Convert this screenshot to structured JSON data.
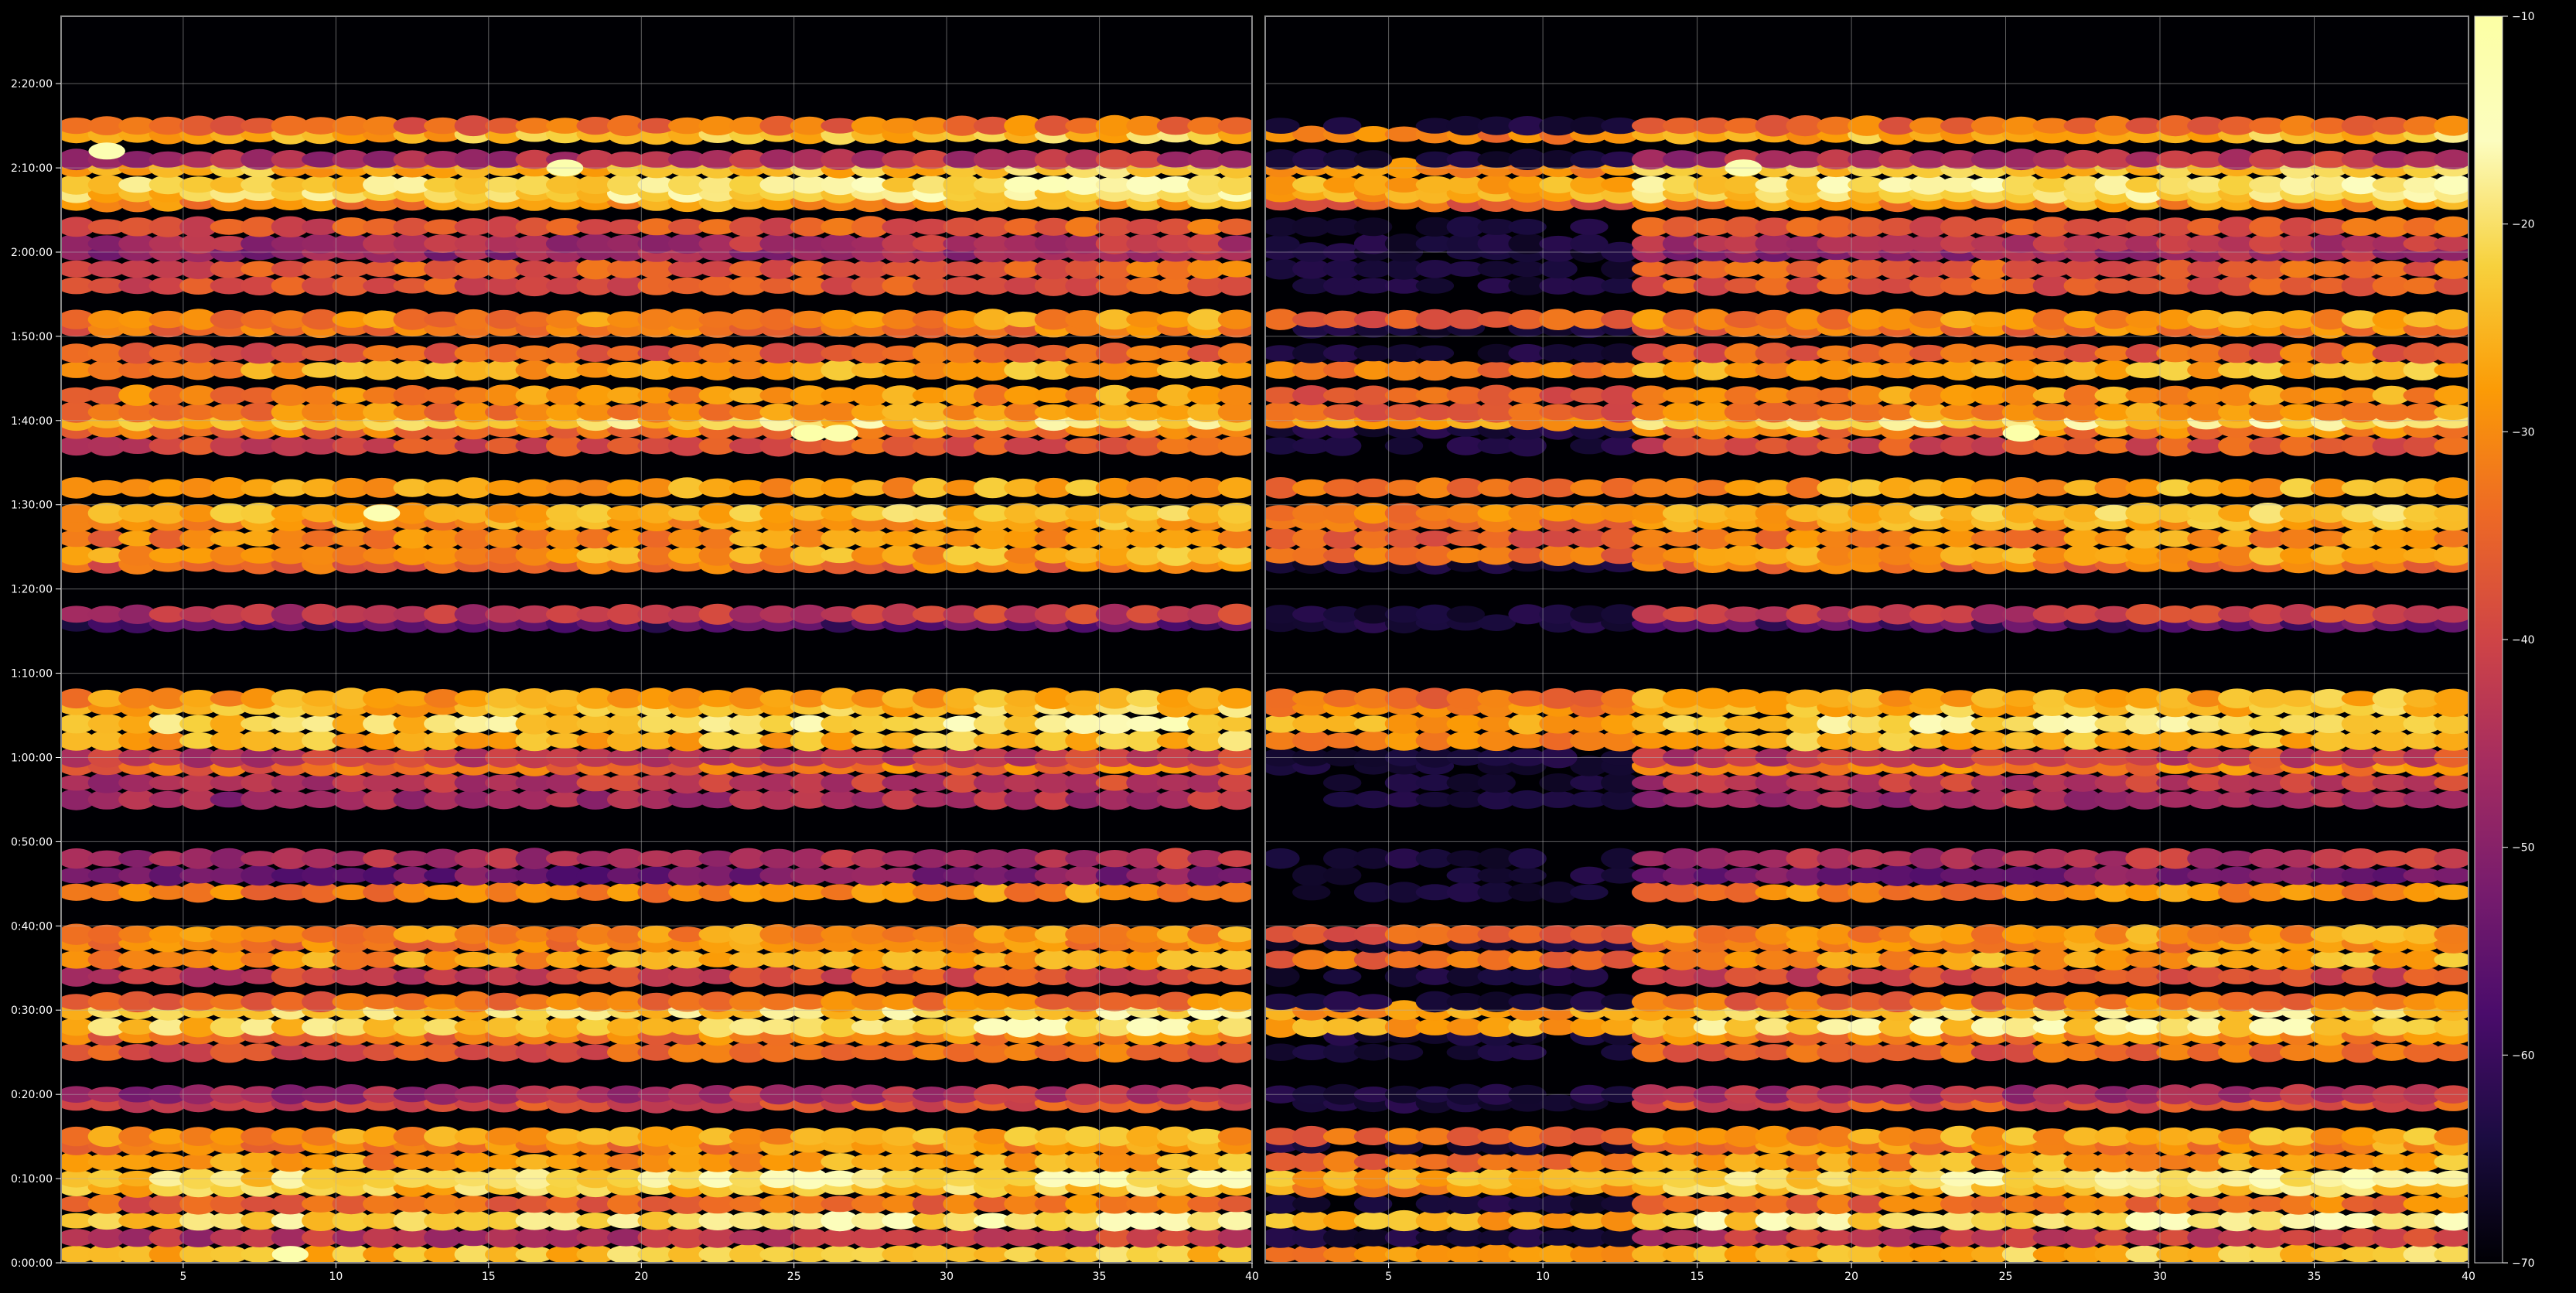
{
  "chart_data": {
    "type": "heatmap",
    "title": "",
    "xlabel": "",
    "ylabel": "",
    "colormap": "inferno",
    "background_color": "#000000",
    "grid": true,
    "panels": [
      {
        "name": "",
        "xlim": [
          1,
          40
        ],
        "xticks": [
          5,
          10,
          15,
          20,
          25,
          30,
          35,
          40
        ],
        "x_tick_labels": [
          "5",
          "10",
          "15",
          "20",
          "25",
          "30",
          "35",
          "40"
        ]
      },
      {
        "name": "",
        "xlim": [
          1,
          40
        ],
        "xticks": [
          5,
          10,
          15,
          20,
          25,
          30,
          35,
          40
        ],
        "x_tick_labels": [
          "5",
          "10",
          "15",
          "20",
          "25",
          "30",
          "35",
          "40"
        ]
      }
    ],
    "y_axis": {
      "unit": "minutes",
      "ylim": [
        0,
        148
      ],
      "ticks": [
        0,
        10,
        20,
        30,
        40,
        50,
        60,
        70,
        80,
        90,
        100,
        110,
        120,
        130,
        140
      ],
      "tick_labels": [
        "0:00:00",
        "0:10:00",
        "0:20:00",
        "0:30:00",
        "0:40:00",
        "0:50:00",
        "1:00:00",
        "1:10:00",
        "1:20:00",
        "1:30:00",
        "1:40:00",
        "1:50:00",
        "2:00:00",
        "2:10:00",
        "2:20:00"
      ]
    },
    "colorbar": {
      "range": [
        -70,
        -10
      ],
      "ticks": [
        -70,
        -60,
        -50,
        -40,
        -30,
        -20,
        -10
      ],
      "tick_labels": [
        "−70",
        "−60",
        "−50",
        "−40",
        "−30",
        "−20",
        "−10"
      ]
    },
    "row_profile": {
      "description_values": "approximate mean intensity (colorbar units) per time row, estimated from image",
      "rows_minutes": [
        1,
        3,
        5,
        7,
        9,
        10,
        12,
        14,
        15,
        19,
        20,
        25,
        27,
        28,
        30,
        31,
        34,
        36,
        38,
        39,
        44,
        46,
        48,
        55,
        57,
        59,
        60,
        62,
        64,
        66,
        67,
        76,
        77,
        83,
        84,
        86,
        88,
        89,
        92,
        97,
        99,
        100,
        101,
        103,
        106,
        108,
        111,
        112,
        116,
        118,
        120,
        121,
        123,
        126,
        127,
        128,
        130,
        131,
        134,
        135
      ],
      "values": [
        -26,
        -45,
        -22,
        -36,
        -25,
        -22,
        -30,
        -33,
        -30,
        -40,
        -48,
        -38,
        -34,
        -23,
        -24,
        -35,
        -42,
        -30,
        -33,
        -32,
        -33,
        -55,
        -47,
        -48,
        -45,
        -35,
        -44,
        -27,
        -23,
        -27,
        -29,
        -60,
        -45,
        -36,
        -30,
        -32,
        -30,
        -27,
        -30,
        -40,
        -34,
        -24,
        -32,
        -32,
        -29,
        -38,
        -35,
        -32,
        -39,
        -38,
        -50,
        -47,
        -39,
        -31,
        -23,
        -22,
        -26,
        -47,
        -27,
        -36
      ]
    },
    "panel2_silent_columns_x": [
      1,
      12
    ],
    "highlights": [
      {
        "panel": 1,
        "x": 8,
        "minutes": 1,
        "value": -12
      },
      {
        "panel": 1,
        "x": 25,
        "minutes": 98.5,
        "value": -11
      },
      {
        "panel": 1,
        "x": 26,
        "minutes": 98.5,
        "value": -12
      },
      {
        "panel": 1,
        "x": 17,
        "minutes": 130,
        "value": -12
      },
      {
        "panel": 1,
        "x": 2,
        "minutes": 132,
        "value": -13
      },
      {
        "panel": 1,
        "x": 11,
        "minutes": 89,
        "value": -13
      },
      {
        "panel": 2,
        "x": 25,
        "minutes": 98.5,
        "value": -11
      },
      {
        "panel": 2,
        "x": 16,
        "minutes": 130,
        "value": -13
      }
    ]
  }
}
